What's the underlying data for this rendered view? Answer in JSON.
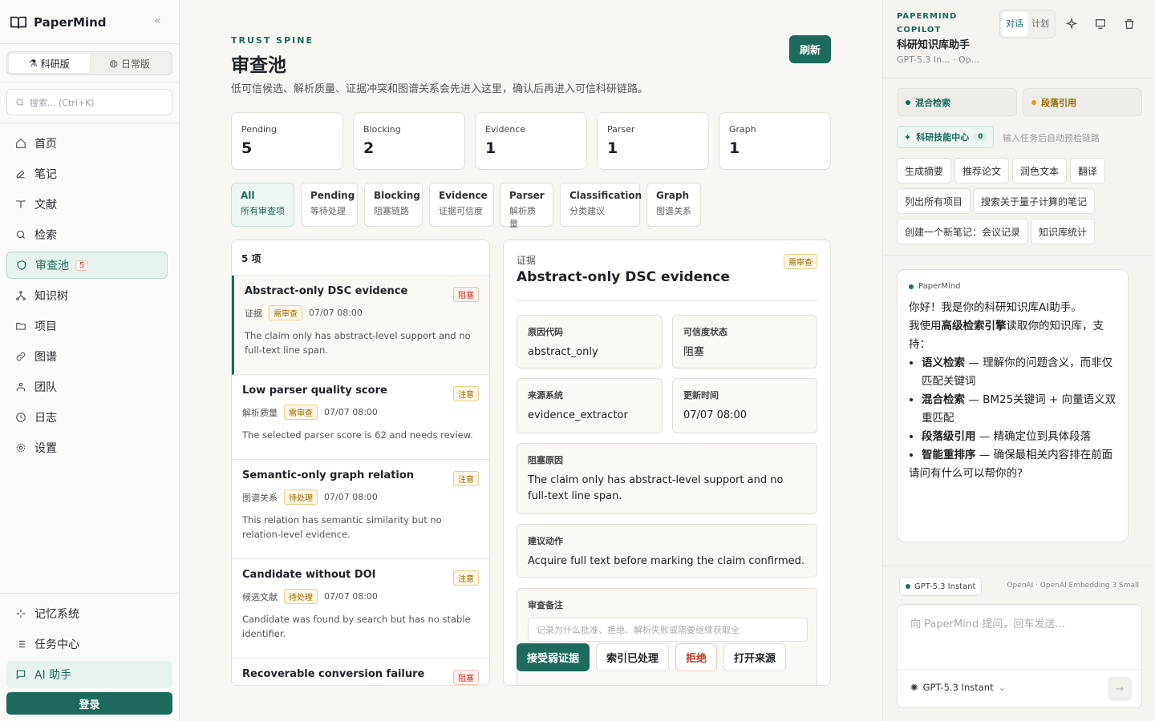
{
  "sidebar": {
    "brand": "PaperMind",
    "mode_tabs": [
      "科研版",
      "日常版"
    ],
    "search_placeholder": "搜索... (Ctrl+K)",
    "nav": [
      "首页",
      "笔记",
      "文献",
      "检索",
      "审查池",
      "知识树",
      "项目",
      "图谱",
      "团队",
      "日志",
      "设置"
    ],
    "review_count": "5",
    "bottom_nav": [
      "记忆系统",
      "任务中心",
      "AI 助手"
    ],
    "login": "登录"
  },
  "page": {
    "eyebrow": "TRUST SPINE",
    "title": "审查池",
    "description": "低可信候选、解析质量、证据冲突和图谱关系会先进入这里，确认后再进入可信科研链路。",
    "refresh": "刷新"
  },
  "stats": [
    {
      "label": "Pending",
      "value": "5"
    },
    {
      "label": "Blocking",
      "value": "2"
    },
    {
      "label": "Evidence",
      "value": "1"
    },
    {
      "label": "Parser",
      "value": "1"
    },
    {
      "label": "Graph",
      "value": "1"
    }
  ],
  "filters": [
    {
      "en": "All",
      "zh": "所有审查项"
    },
    {
      "en": "Pending",
      "zh": "等待处理"
    },
    {
      "en": "Blocking",
      "zh": "阻塞链路"
    },
    {
      "en": "Evidence",
      "zh": "证据可信度"
    },
    {
      "en": "Parser",
      "zh": "解析质量"
    },
    {
      "en": "Classification",
      "zh": "分类建议"
    },
    {
      "en": "Graph",
      "zh": "图谱关系"
    }
  ],
  "list": {
    "count": "5 项",
    "items": [
      {
        "title": "Abstract-only DSC evidence",
        "severity": "阻塞",
        "category": "证据",
        "status": "需审查",
        "time": "07/07 08:00",
        "desc": "The claim only has abstract-level support and no full-text line span."
      },
      {
        "title": "Low parser quality score",
        "severity": "注意",
        "category": "解析质量",
        "status": "需审查",
        "time": "07/07 08:00",
        "desc": "The selected parser score is 62 and needs review."
      },
      {
        "title": "Semantic-only graph relation",
        "severity": "注意",
        "category": "图谱关系",
        "status": "待处理",
        "time": "07/07 08:00",
        "desc": "This relation has semantic similarity but no relation-level evidence."
      },
      {
        "title": "Candidate without DOI",
        "severity": "注意",
        "category": "候选文献",
        "status": "待处理",
        "time": "07/07 08:00",
        "desc": "Candidate was found by search but has no stable identifier."
      },
      {
        "title": "Recoverable conversion failure",
        "severity": "阻塞"
      }
    ]
  },
  "detail": {
    "category": "证据",
    "title": "Abstract-only DSC evidence",
    "status": "需审查",
    "fields": [
      {
        "k": "原因代码",
        "v": "abstract_only"
      },
      {
        "k": "可信度状态",
        "v": "阻塞"
      },
      {
        "k": "来源系统",
        "v": "evidence_extractor"
      },
      {
        "k": "更新时间",
        "v": "07/07 08:00"
      }
    ],
    "block_reason_label": "阻塞原因",
    "block_reason": "The claim only has abstract-level support and no full-text line span.",
    "action_label": "建议动作",
    "action": "Acquire full text before marking the claim confirmed.",
    "note_label": "审查备注",
    "note_placeholder": "记录为什么批准、拒绝、解析失败或需要继续获取全",
    "buttons": [
      "接受弱证据",
      "索引已处理",
      "拒绝",
      "打开来源"
    ]
  },
  "copilot": {
    "brand": "PAPERMIND COPILOT",
    "name": "科研知识库助手",
    "sub": "GPT-5.3 In...   ·   Op...",
    "seg": [
      "对话",
      "计划"
    ],
    "chips": [
      "混合检索",
      "段落引用"
    ],
    "skill": "科研技能中心",
    "skill_count": "0",
    "skill_hint": "输入任务后自动预检链路",
    "suggestions": [
      "生成摘要",
      "推荐论文",
      "润色文本",
      "翻译",
      "列出所有项目",
      "搜索关于量子计算的笔记",
      "创建一个新笔记：会议记录",
      "知识库统计"
    ],
    "chat": {
      "who": "PaperMind",
      "hello": "你好！我是你的科研知识库AI助手。",
      "intro_a": "我使用",
      "intro_b": "高级检索引擎",
      "intro_c": "读取你的知识库，支持：",
      "bullets": [
        {
          "b": "语义检索",
          "t": " — 理解你的问题含义，而非仅匹配关键词"
        },
        {
          "b": "混合检索",
          "t": " — BM25关键词 + 向量语义双重匹配"
        },
        {
          "b": "段落级引用",
          "t": " — 精确定位到具体段落"
        },
        {
          "b": "智能重排序",
          "t": " — 确保最相关内容排在前面"
        }
      ],
      "ask": "请问有什么可以帮你的?"
    },
    "model_tag": "GPT-5.3 Instant",
    "embed": "OpenAI · OpenAI Embedding 3 Small",
    "input_placeholder": "向 PaperMind 提问，回车发送...",
    "model_select": "GPT-5.3 Instant"
  },
  "colors": {
    "accent": "#1c6b5c",
    "danger": "#c0392b",
    "warn": "#9a6a00"
  }
}
